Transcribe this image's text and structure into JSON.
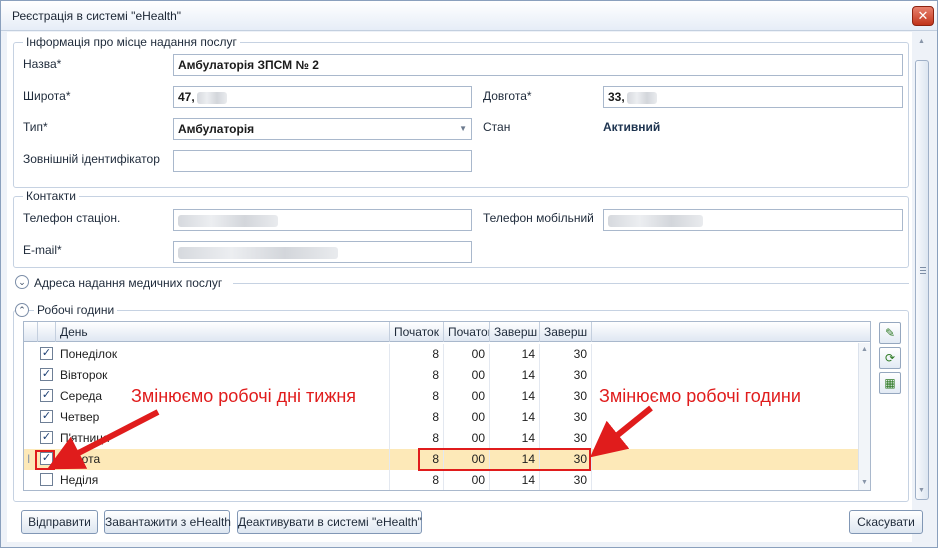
{
  "window": {
    "title": "Реєстрація в системі \"eHealth\"",
    "close_glyph": "✕"
  },
  "service_info": {
    "legend": "Інформація про місце надання послуг",
    "name_label": "Назва*",
    "name_value": "Амбулаторія ЗПСМ № 2",
    "lat_label": "Широта*",
    "lat_value": "47,",
    "lon_label": "Довгота*",
    "lon_value": "33,",
    "type_label": "Тип*",
    "type_value": "Амбулаторія",
    "status_label": "Стан",
    "status_value": "Активний",
    "ext_id_label": "Зовнішній ідентифікатор",
    "ext_id_value": ""
  },
  "contacts": {
    "legend": "Контакти",
    "phone_label": "Телефон стаціон.",
    "mobile_label": "Телефон мобільний",
    "email_label": "E-mail*"
  },
  "address_section": {
    "legend": "Адреса надання медичних послуг"
  },
  "work_hours": {
    "legend": "Робочі години",
    "columns": [
      "День",
      "Початок",
      "Початок",
      "Заверш",
      "Заверш"
    ],
    "rows": [
      {
        "day": "Понеділок",
        "sh": "8",
        "sm": "00",
        "eh": "14",
        "em": "30",
        "checked": true
      },
      {
        "day": "Вівторок",
        "sh": "8",
        "sm": "00",
        "eh": "14",
        "em": "30",
        "checked": true
      },
      {
        "day": "Середа",
        "sh": "8",
        "sm": "00",
        "eh": "14",
        "em": "30",
        "checked": true
      },
      {
        "day": "Четвер",
        "sh": "8",
        "sm": "00",
        "eh": "14",
        "em": "30",
        "checked": true
      },
      {
        "day": "П'ятниця",
        "sh": "8",
        "sm": "00",
        "eh": "14",
        "em": "30",
        "checked": true
      },
      {
        "day": "Субота",
        "sh": "8",
        "sm": "00",
        "eh": "14",
        "em": "30",
        "checked": true
      },
      {
        "day": "Неділя",
        "sh": "8",
        "sm": "00",
        "eh": "14",
        "em": "30",
        "checked": false
      }
    ],
    "row_indicator": "I"
  },
  "annotations": {
    "days": "Змінюємо робочі дні тижня",
    "hours": "Змінюємо робочі години",
    "color": "#e01c1c"
  },
  "buttons": {
    "send": "Відправити",
    "load": "Завантажити з eHealth",
    "deactivate": "Деактивувати в системі \"eHealth\"",
    "cancel": "Скасувати"
  },
  "icons": {
    "collapse": "⌄",
    "expand": "⌃",
    "checkmark": "✓"
  }
}
